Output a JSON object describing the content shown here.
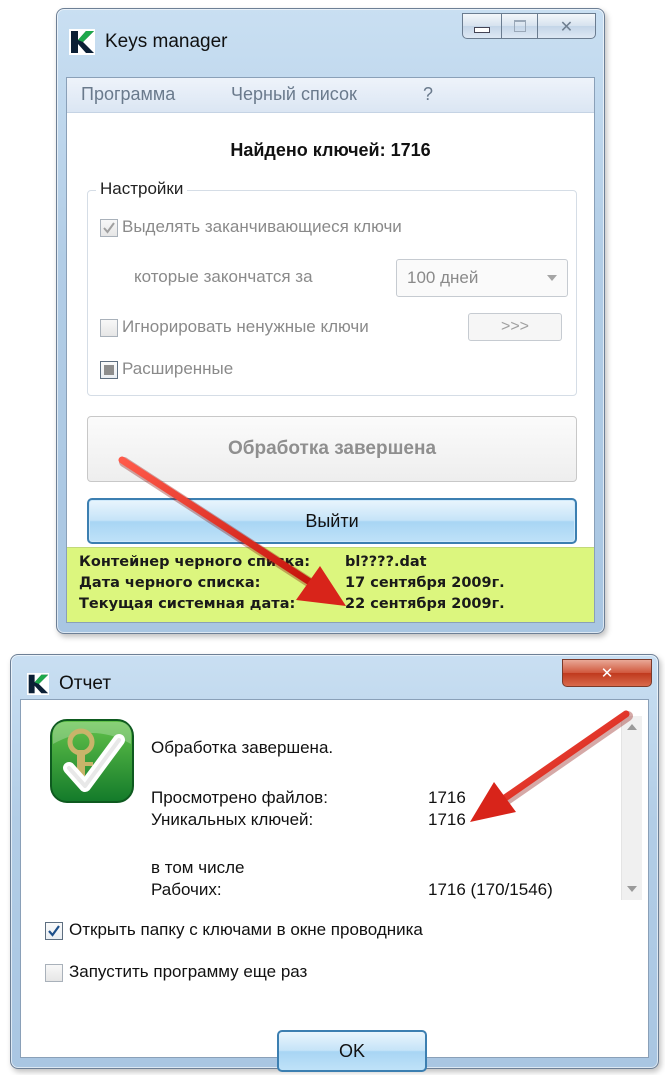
{
  "keys_window": {
    "title": "Keys manager",
    "menu": [
      "Программа",
      "Черный список",
      "?"
    ],
    "found_label": "Найдено ключей: 1716",
    "settings": {
      "group_label": "Настройки",
      "highlight_label": "Выделять заканчивающиеся ключи",
      "highlight_checked": true,
      "expire_label": "которые закончатся за",
      "expire_value": "100 дней",
      "ignore_label": "Игнорировать ненужные ключи",
      "ignore_checked": false,
      "more_button": ">>>",
      "extended_label": "Расширенные"
    },
    "process_button": "Обработка завершена",
    "exit_button": "Выйти",
    "status": [
      {
        "label": "Контейнер черного списка:",
        "value": "bl????.dat"
      },
      {
        "label": "Дата черного списка:",
        "value": "17 сентября 2009г."
      },
      {
        "label": "Текущая системная дата:",
        "value": "22 сентября 2009г."
      }
    ]
  },
  "report_window": {
    "title": "Отчет",
    "heading": "Обработка завершена.",
    "rows": [
      {
        "label": "Просмотрено файлов:",
        "value": "1716"
      },
      {
        "label": "Уникальных ключей:",
        "value": "1716"
      }
    ],
    "subheading": "в том числе",
    "working": {
      "label": "Рабочих:",
      "value": "1716 (170/1546)"
    },
    "open_folder_label": "Открыть папку с ключами в окне проводника",
    "open_folder_checked": true,
    "restart_label": "Запустить программу еще раз",
    "restart_checked": false,
    "ok_button": "OK"
  },
  "colors": {
    "status_bg": "#dcf67e",
    "arrow": "#e8271d",
    "button_border": "#3c7fb1"
  }
}
